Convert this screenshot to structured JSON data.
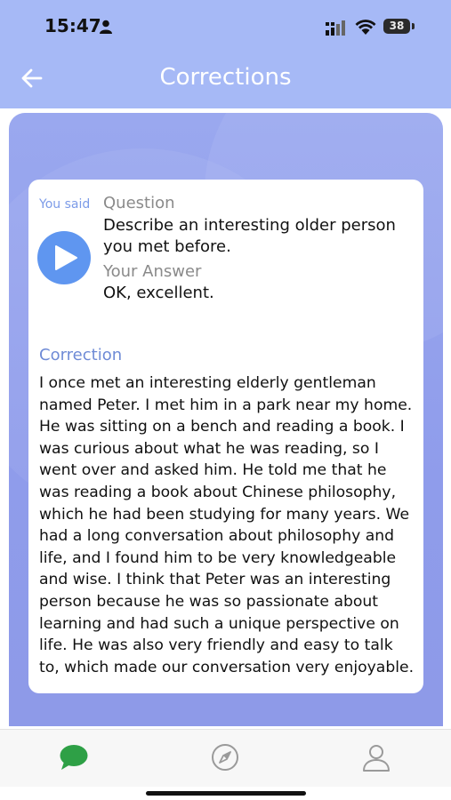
{
  "status": {
    "time": "15:47",
    "battery": "38"
  },
  "header": {
    "title": "Corrections"
  },
  "card": {
    "you_said": "You said",
    "question_label": "Question",
    "question_text": "Describe an interesting older person you met before.",
    "answer_label": "Your Answer",
    "answer_text": "OK, excellent.",
    "correction_label": "Correction",
    "correction_text": "I once met an interesting elderly gentleman named Peter. I met him in a park near my home. He was sitting on a bench and reading a book. I was curious about what he was reading, so I went over and asked him. He told me that he was reading a book about Chinese philosophy, which he had been studying for many years. We had a long conversation about philosophy and life, and I found him to be very knowledgeable and wise. I think that Peter was an interesting person because he was so passionate about learning and had such a unique perspective on life. He was also very friendly and easy to talk to, which made our conversation very enjoyable."
  },
  "tabs": [
    {
      "icon": "chat-bubble-icon",
      "active": true
    },
    {
      "icon": "compass-icon",
      "active": false
    },
    {
      "icon": "person-icon",
      "active": false
    }
  ],
  "colors": {
    "header_bg": "#a6b9f6",
    "panel_bg": "#939fec",
    "accent_blue": "#5f96f0",
    "active_tab": "#2ea046"
  }
}
